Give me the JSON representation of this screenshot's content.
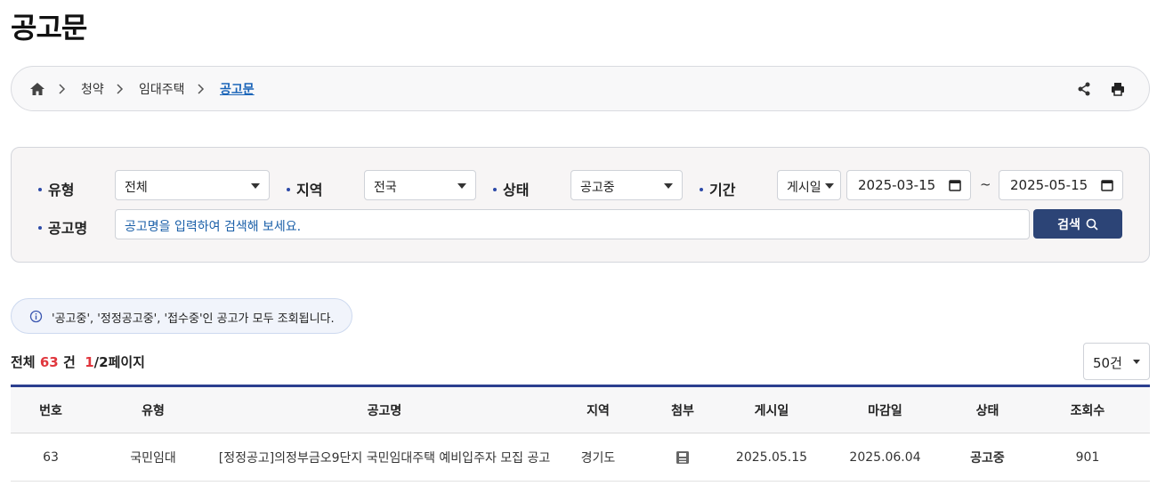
{
  "page": {
    "title": "공고문"
  },
  "breadcrumb": {
    "home_icon": "home-icon",
    "items": [
      "청약",
      "임대주택"
    ],
    "current": "공고문",
    "share_icon": "share-icon",
    "print_icon": "print-icon"
  },
  "search": {
    "type_label": "유형",
    "type_value": "전체",
    "region_label": "지역",
    "region_value": "전국",
    "status_label": "상태",
    "status_value": "공고중",
    "period_label": "기간",
    "period_type_value": "게시일",
    "date_from": "2025-03-15",
    "date_to": "2025-05-15",
    "tilde": "~",
    "name_label": "공고명",
    "name_placeholder": "공고명을 입력하여 검색해 보세요.",
    "button_label": "검색",
    "accent_color": "#2c4476"
  },
  "notice": {
    "text": "'공고중', '정정공고중', '접수중'인 공고가 모두 조회됩니다."
  },
  "summary": {
    "total_prefix": "전체",
    "total_count": "63",
    "total_suffix": "건",
    "current_page": "1",
    "total_pages": "/2페이지"
  },
  "per_page": {
    "value": "50건"
  },
  "table": {
    "headers": [
      "번호",
      "유형",
      "공고명",
      "지역",
      "첨부",
      "게시일",
      "마감일",
      "상태",
      "조회수"
    ],
    "rows": [
      {
        "no": "63",
        "type": "국민임대",
        "title": "[정정공고]의정부금오9단지 국민임대주택 예비입주자 모집 공고",
        "region": "경기도",
        "attachment_icon": "file-icon",
        "posted": "2025.05.15",
        "deadline": "2025.06.04",
        "status": "공고중",
        "views": "901"
      }
    ]
  }
}
